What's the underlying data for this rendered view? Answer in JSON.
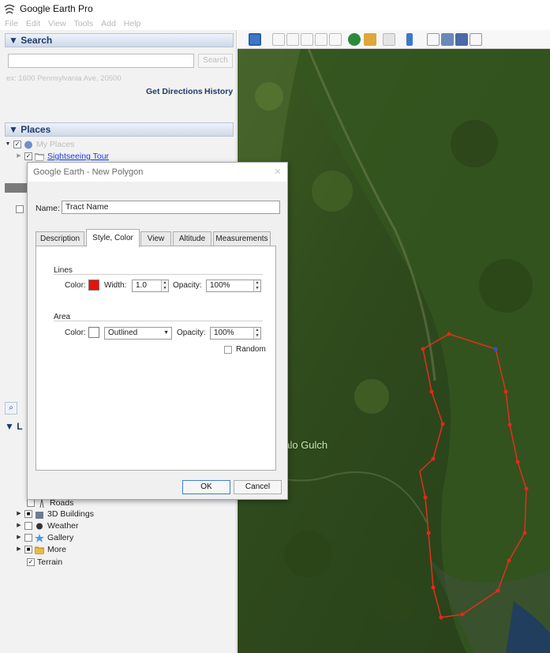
{
  "window": {
    "title": "Google Earth Pro"
  },
  "menu": [
    "File",
    "Edit",
    "View",
    "Tools",
    "Add",
    "Help"
  ],
  "search": {
    "header": "▼ Search",
    "button": "Search",
    "hint": "ex: 1600 Pennsylvania Ave, 20500",
    "get_directions": "Get Directions",
    "history": "History"
  },
  "places": {
    "header": "▼ Places",
    "my_places": "My Places",
    "sightseeing_tour": "Sightseeing Tour"
  },
  "layers": {
    "header": "▼ L",
    "items": [
      {
        "label": "Roads"
      },
      {
        "label": "3D Buildings"
      },
      {
        "label": "Weather"
      },
      {
        "label": "Gallery"
      },
      {
        "label": "More"
      },
      {
        "label": "Terrain"
      }
    ]
  },
  "map": {
    "label": "aalo Gulch"
  },
  "dialog": {
    "title": "Google Earth - New Polygon",
    "name_label": "Name:",
    "name_value": "Tract Name",
    "tabs": [
      "Description",
      "Style, Color",
      "View",
      "Altitude",
      "Measurements"
    ],
    "active_tab": "Style, Color",
    "lines": {
      "label": "Lines",
      "color_label": "Color:",
      "color": "#e3120b",
      "width_label": "Width:",
      "width_value": "1.0",
      "opacity_label": "Opacity:",
      "opacity_value": "100%"
    },
    "area": {
      "label": "Area",
      "color_label": "Color:",
      "color": "#ffffff",
      "fill_mode": "Outlined",
      "opacity_label": "Opacity:",
      "opacity_value": "100%",
      "random_label": "Random"
    },
    "ok": "OK",
    "cancel": "Cancel"
  }
}
